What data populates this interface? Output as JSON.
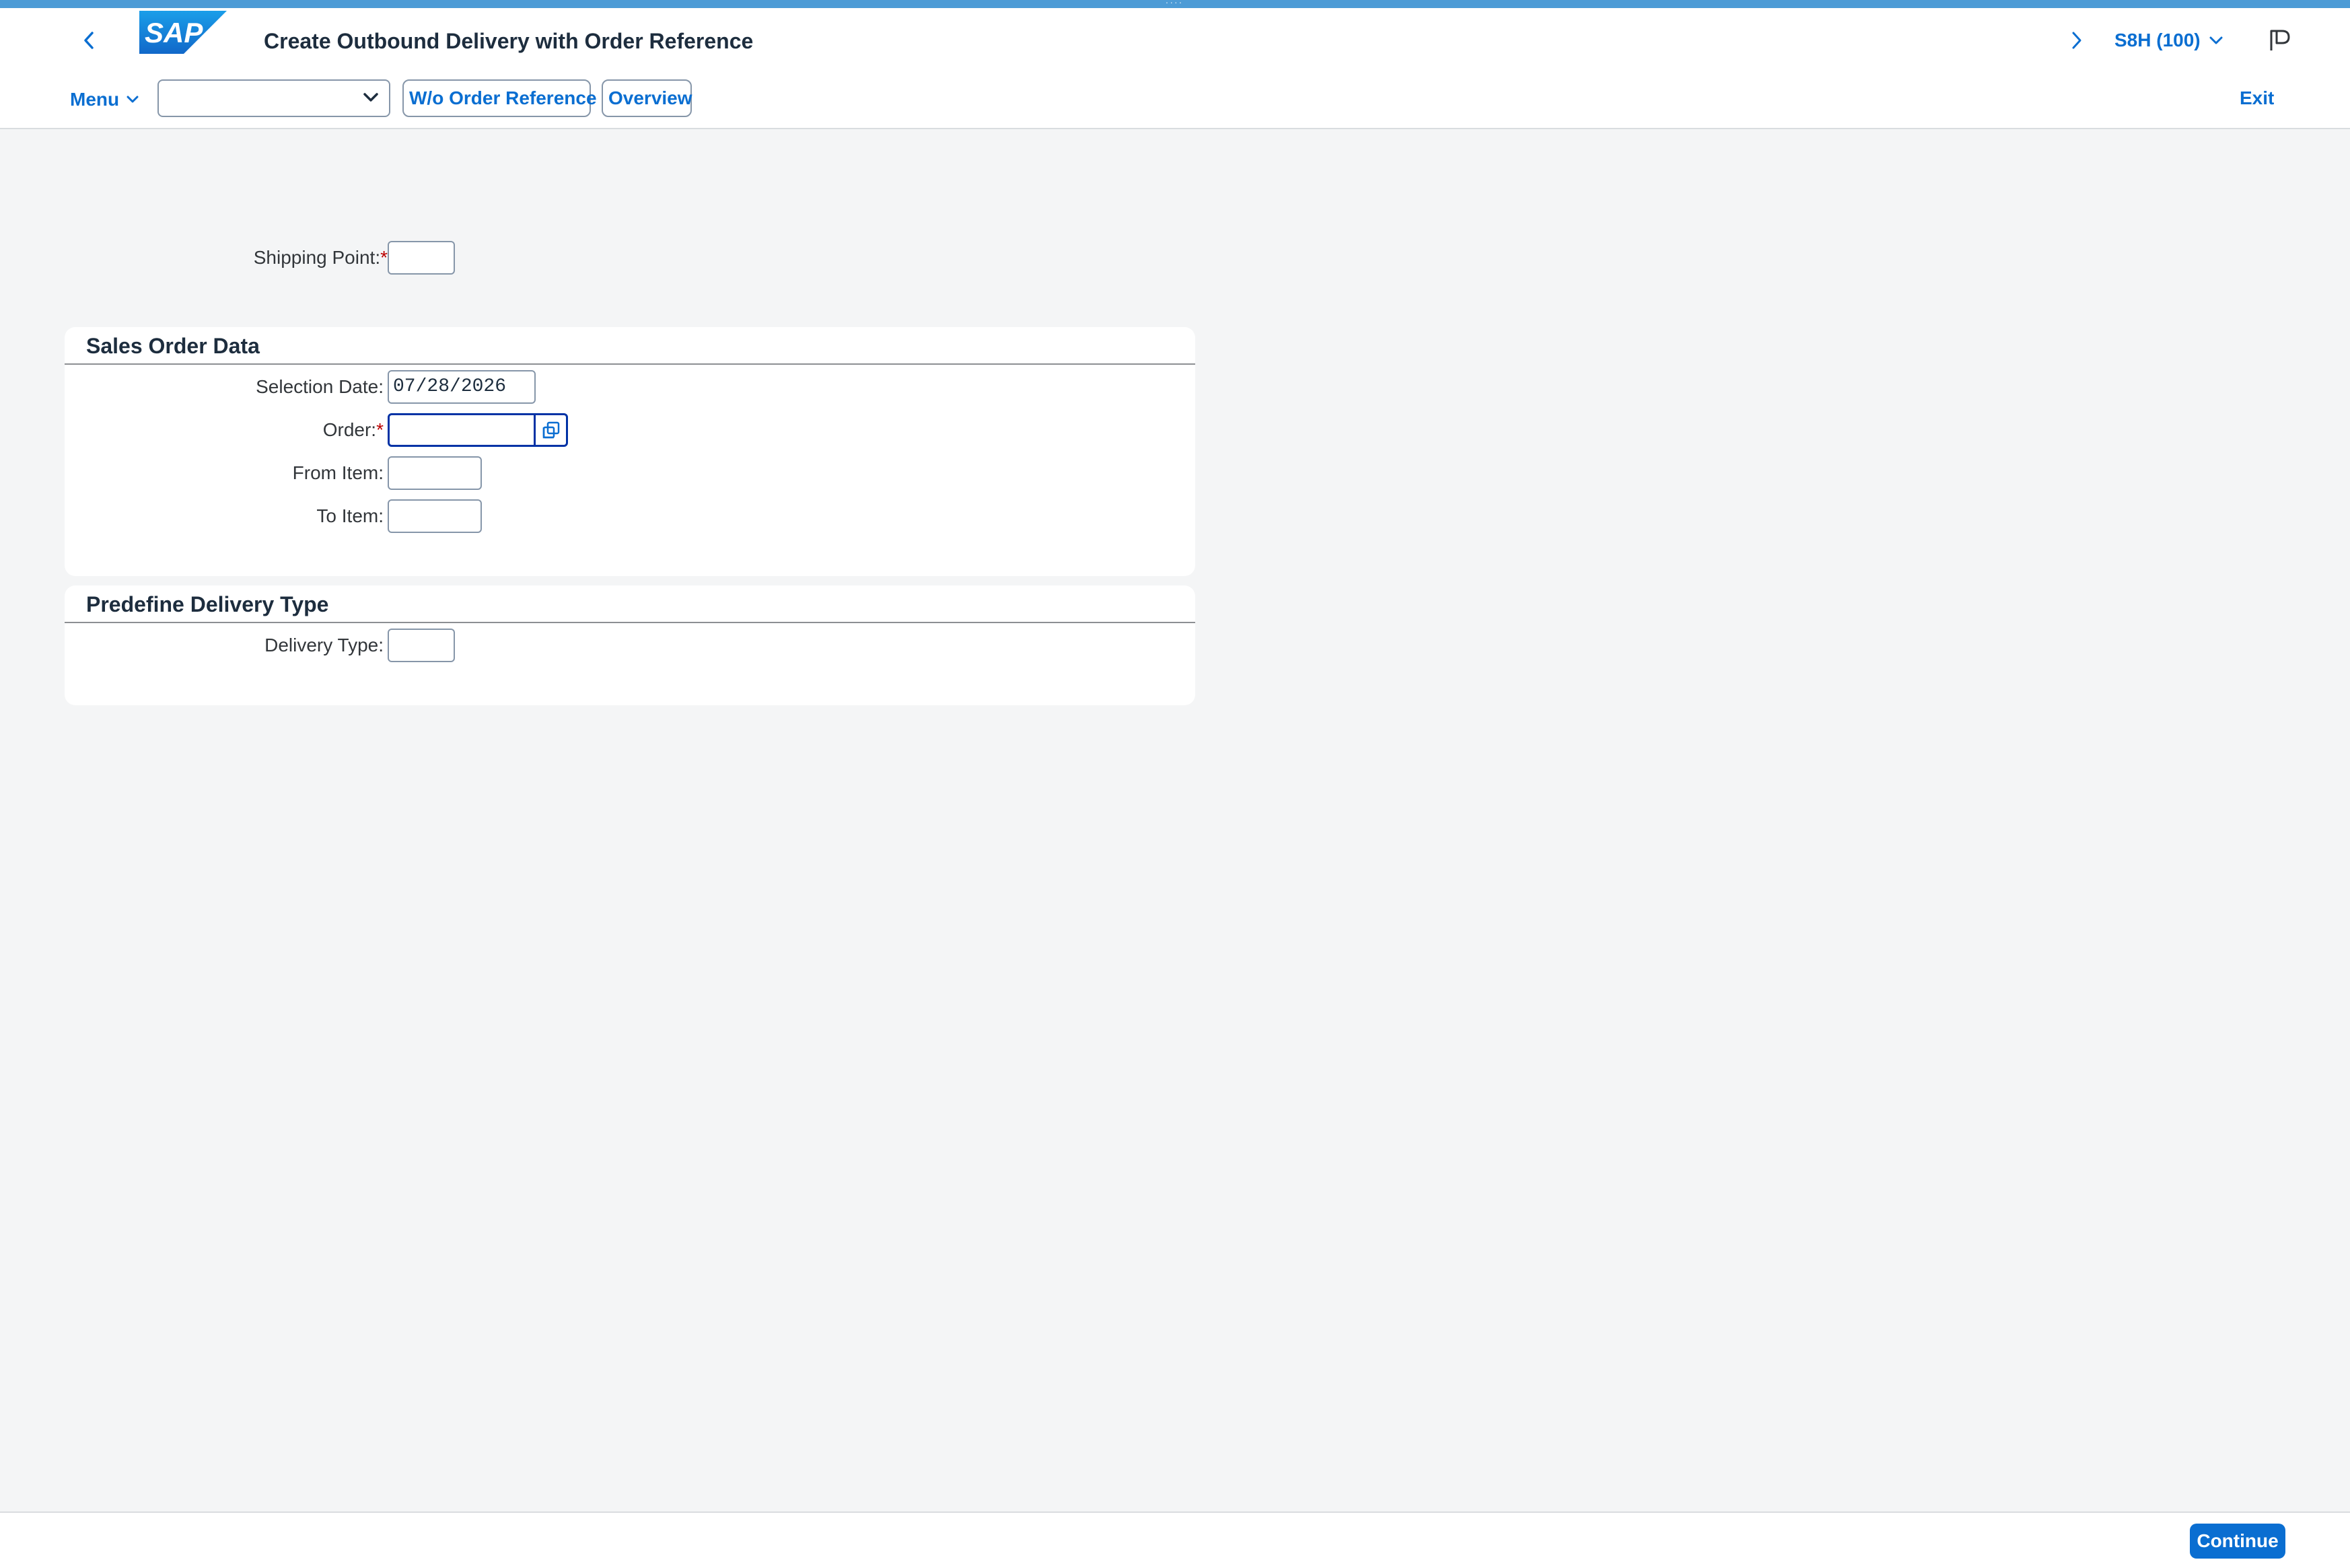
{
  "header": {
    "title": "Create Outbound Delivery with Order Reference",
    "system": "S8H (100)",
    "logo_text": "SAP"
  },
  "toolbar": {
    "menu_label": "Menu",
    "select_value": "",
    "wo_order_ref_label": "W/o Order Reference",
    "overview_label": "Overview",
    "exit_label": "Exit"
  },
  "form": {
    "shipping_point_label": "Shipping Point:",
    "required_mark": "*",
    "shipping_point_value": ""
  },
  "sales_order": {
    "section_title": "Sales Order Data",
    "selection_date_label": "Selection Date:",
    "selection_date_value": "07/28/2026",
    "order_label": "Order:",
    "order_value": "",
    "from_item_label": "From Item:",
    "from_item_value": "",
    "to_item_label": "To Item:",
    "to_item_value": ""
  },
  "delivery_type": {
    "section_title": "Predefine Delivery Type",
    "delivery_type_label": "Delivery Type:",
    "delivery_type_value": ""
  },
  "footer": {
    "continue_label": "Continue"
  },
  "colors": {
    "accent": "#0a6ed1",
    "focus": "#0032a5",
    "required": "#bb0000",
    "background": "#f4f5f6"
  }
}
